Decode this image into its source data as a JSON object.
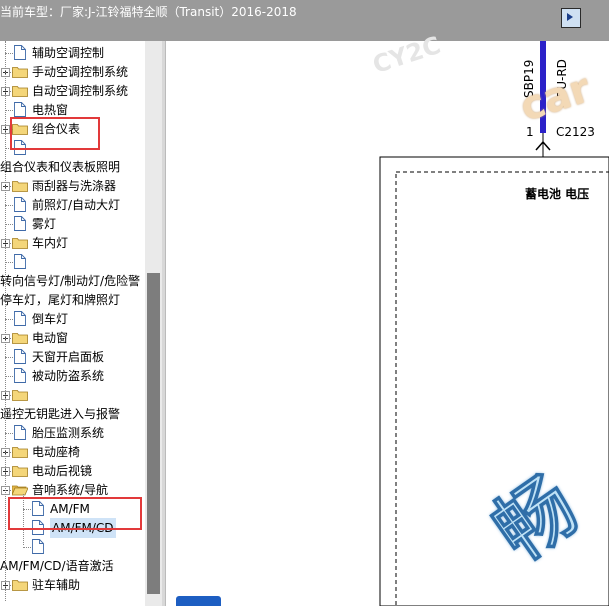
{
  "title_bar": {
    "text": "当前车型：厂家:J-江铃福特全顺（Transit）2016-2018"
  },
  "tree": {
    "items": [
      {
        "label": "辅助空调控制",
        "icon": "doc",
        "expander": "none",
        "level": 1
      },
      {
        "label": "手动空调控制系统",
        "icon": "folder",
        "expander": "plus",
        "level": 1
      },
      {
        "label": "自动空调控制系统",
        "icon": "folder",
        "expander": "plus",
        "level": 1
      },
      {
        "label": "电热窗",
        "icon": "doc",
        "expander": "none",
        "level": 1
      },
      {
        "label": "组合仪表",
        "icon": "folder",
        "expander": "plus",
        "level": 1
      },
      {
        "label": "",
        "icon": "doc",
        "expander": "none",
        "level": 1
      },
      {
        "label": "组合仪表和仪表板照明",
        "icon": "none",
        "expander": "none",
        "level": 0
      },
      {
        "label": "雨刮器与洗涤器",
        "icon": "folder",
        "expander": "plus",
        "level": 1
      },
      {
        "label": "前照灯/自动大灯",
        "icon": "doc",
        "expander": "none",
        "level": 1
      },
      {
        "label": "雾灯",
        "icon": "doc",
        "expander": "none",
        "level": 1
      },
      {
        "label": "车内灯",
        "icon": "folder",
        "expander": "plus",
        "level": 1
      },
      {
        "label": "",
        "icon": "doc",
        "expander": "none",
        "level": 1
      },
      {
        "label": "转向信号灯/制动灯/危险警",
        "icon": "none",
        "expander": "none",
        "level": 0
      },
      {
        "label": "停车灯，尾灯和牌照灯",
        "icon": "none",
        "expander": "none",
        "level": 0
      },
      {
        "label": "倒车灯",
        "icon": "doc",
        "expander": "none",
        "level": 1
      },
      {
        "label": "电动窗",
        "icon": "folder",
        "expander": "plus",
        "level": 1
      },
      {
        "label": "天窗开启面板",
        "icon": "doc",
        "expander": "none",
        "level": 1
      },
      {
        "label": "被动防盗系统",
        "icon": "doc",
        "expander": "none",
        "level": 1
      },
      {
        "label": "",
        "icon": "folder",
        "expander": "plus",
        "level": 1
      },
      {
        "label": "遥控无钥匙进入与报警",
        "icon": "none",
        "expander": "none",
        "level": 0
      },
      {
        "label": "胎压监测系统",
        "icon": "doc",
        "expander": "none",
        "level": 1
      },
      {
        "label": "电动座椅",
        "icon": "folder",
        "expander": "plus",
        "level": 1
      },
      {
        "label": "电动后视镜",
        "icon": "folder",
        "expander": "plus",
        "level": 1
      },
      {
        "label": "音响系统/导航",
        "icon": "folder-open",
        "expander": "minus",
        "level": 1
      },
      {
        "label": "AM/FM",
        "icon": "doc",
        "expander": "none",
        "level": 2
      },
      {
        "label": "AM/FM/CD",
        "icon": "doc",
        "expander": "none",
        "level": 2,
        "selected": true
      },
      {
        "label": "",
        "icon": "doc",
        "expander": "none",
        "level": 2
      },
      {
        "label": "AM/FM/CD/语音激活",
        "icon": "none",
        "expander": "none",
        "level": 0
      },
      {
        "label": "驻车辅助",
        "icon": "folder",
        "expander": "plus",
        "level": 1
      }
    ]
  },
  "diagram": {
    "wire_code_left": "SBP19",
    "wire_color": "BU-RD",
    "pin_number": "1",
    "connector_id": "C2123",
    "box_label": "蓄电池 电压",
    "watermarks": [
      "CY2C",
      "car",
      "畅"
    ]
  },
  "colors": {
    "title_bar_bg": "#9a9a9a",
    "highlight_red": "#e2393a",
    "wire_blue": "#2b21c9",
    "selection_bg": "#cfe3f7"
  }
}
